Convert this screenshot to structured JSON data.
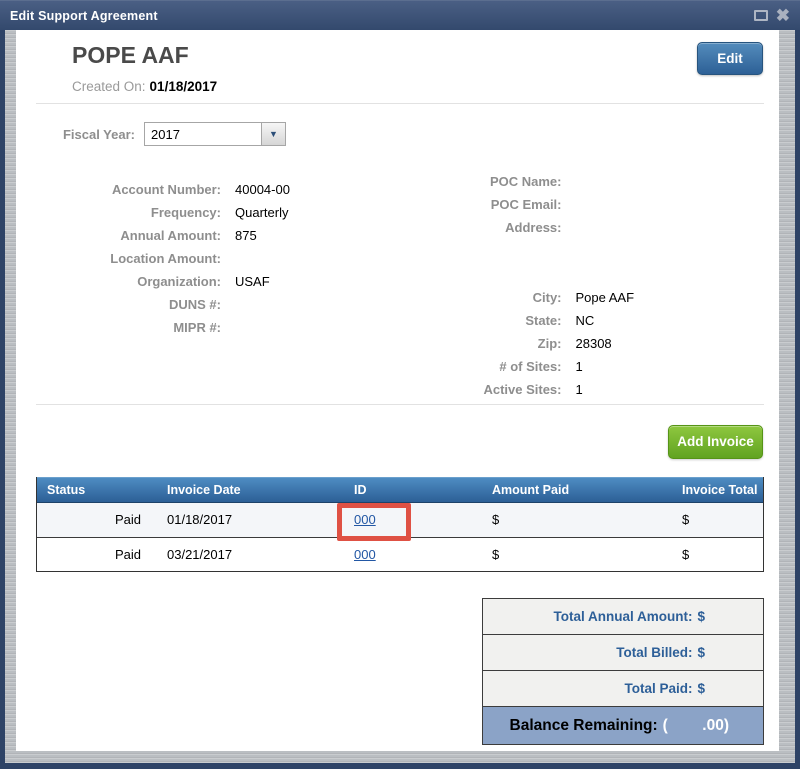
{
  "window": {
    "title": "Edit Support Agreement",
    "maximize_icon": "maximize",
    "close_icon": "close"
  },
  "header": {
    "title": "POPE AAF",
    "edit_button": "Edit",
    "created_on_label": "Created On:",
    "created_on_value": "01/18/2017"
  },
  "fiscal_year": {
    "label": "Fiscal Year:",
    "value": "2017"
  },
  "details": {
    "left": [
      {
        "label": "Account Number:",
        "value": "40004-00"
      },
      {
        "label": "Frequency:",
        "value": "Quarterly"
      },
      {
        "label": "Annual Amount:",
        "value": "875"
      },
      {
        "label": "Location Amount:",
        "value": ""
      },
      {
        "label": "Organization:",
        "value": "USAF"
      },
      {
        "label": "DUNS #:",
        "value": ""
      },
      {
        "label": "MIPR #:",
        "value": ""
      }
    ],
    "right_top": [
      {
        "label": "POC Name:",
        "value": ""
      },
      {
        "label": "POC Email:",
        "value": ""
      },
      {
        "label": "Address:",
        "value": ""
      }
    ],
    "right_bottom": [
      {
        "label": "City:",
        "value": "Pope AAF"
      },
      {
        "label": "State:",
        "value": "NC"
      },
      {
        "label": "Zip:",
        "value": "28308"
      },
      {
        "label": "# of Sites:",
        "value": "1"
      },
      {
        "label": "Active Sites:",
        "value": "1"
      }
    ]
  },
  "invoices": {
    "add_button": "Add Invoice",
    "columns": [
      "Status",
      "Invoice Date",
      "ID",
      "Amount Paid",
      "Invoice Total"
    ],
    "rows": [
      {
        "status": "Paid",
        "date": "01/18/2017",
        "id": "000",
        "amount_paid": "$",
        "invoice_total": "$"
      },
      {
        "status": "Paid",
        "date": "03/21/2017",
        "id": "000",
        "amount_paid": "$",
        "invoice_total": "$"
      }
    ],
    "highlight_note": "red annotation box around first row ID link"
  },
  "summary": {
    "rows": [
      {
        "label": "Total Annual Amount:",
        "value": "$"
      },
      {
        "label": "Total Billed:",
        "value": "$"
      },
      {
        "label": "Total Paid:",
        "value": "$"
      }
    ],
    "balance_label": "Balance Remaining:",
    "balance_value": "(        .00)"
  },
  "colors": {
    "frame_navy": "#2e4366",
    "titlebar_gradient_top": "#4a5f84",
    "titlebar_gradient_bottom": "#33496d",
    "edit_button_blue": "#2d6096",
    "add_invoice_green": "#61a321",
    "table_header_blue": "#2c5f96",
    "link_blue": "#2257a4",
    "summary_text_blue": "#2d5f98",
    "balance_row_blue": "#8ba3c7",
    "annotation_red": "#df5144",
    "label_gray": "#8e8e8e",
    "row_alt_bg": "#f4f6f9"
  }
}
